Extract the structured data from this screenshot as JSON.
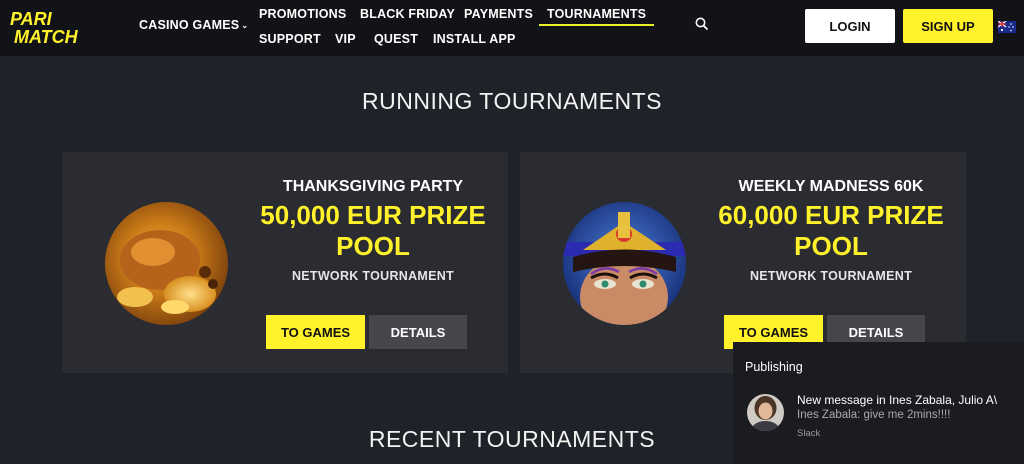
{
  "brand": {
    "line1": "PARI",
    "line2": "MATCH"
  },
  "nav": {
    "casino_games": "CASINO GAMES",
    "items": [
      "PROMOTIONS",
      "BLACK FRIDAY",
      "PAYMENTS",
      "TOURNAMENTS",
      "SUPPORT",
      "VIP",
      "QUEST",
      "INSTALL APP"
    ],
    "active": "TOURNAMENTS"
  },
  "auth": {
    "login": "LOGIN",
    "signup": "SIGN UP"
  },
  "sections": {
    "running": "RUNNING TOURNAMENTS",
    "recent": "RECENT TOURNAMENTS"
  },
  "tournaments": [
    {
      "title": "THANKSGIVING PARTY",
      "prize_line1": "50,000 EUR PRIZE",
      "prize_line2": "POOL",
      "type": "NETWORK TOURNAMENT",
      "btn_games": "TO GAMES",
      "btn_details": "DETAILS"
    },
    {
      "title": "WEEKLY MADNESS 60K",
      "prize_line1": "60,000 EUR PRIZE",
      "prize_line2": "POOL",
      "type": "NETWORK TOURNAMENT",
      "btn_games": "TO GAMES",
      "btn_details": "DETAILS"
    }
  ],
  "notification": {
    "app": "Publishing",
    "title": "New message in Ines Zabala, Julio A\\",
    "body": "Ines Zabala: give me 2mins!!!!",
    "source": "Slack"
  },
  "colors": {
    "accent": "#fff12a",
    "header_bg": "#111317",
    "page_bg": "#1f2229",
    "card_bg": "#2a2c31"
  },
  "icons": {
    "search": "search-icon",
    "flag": "australia-flag-icon",
    "chevron": "chevron-down-icon"
  }
}
